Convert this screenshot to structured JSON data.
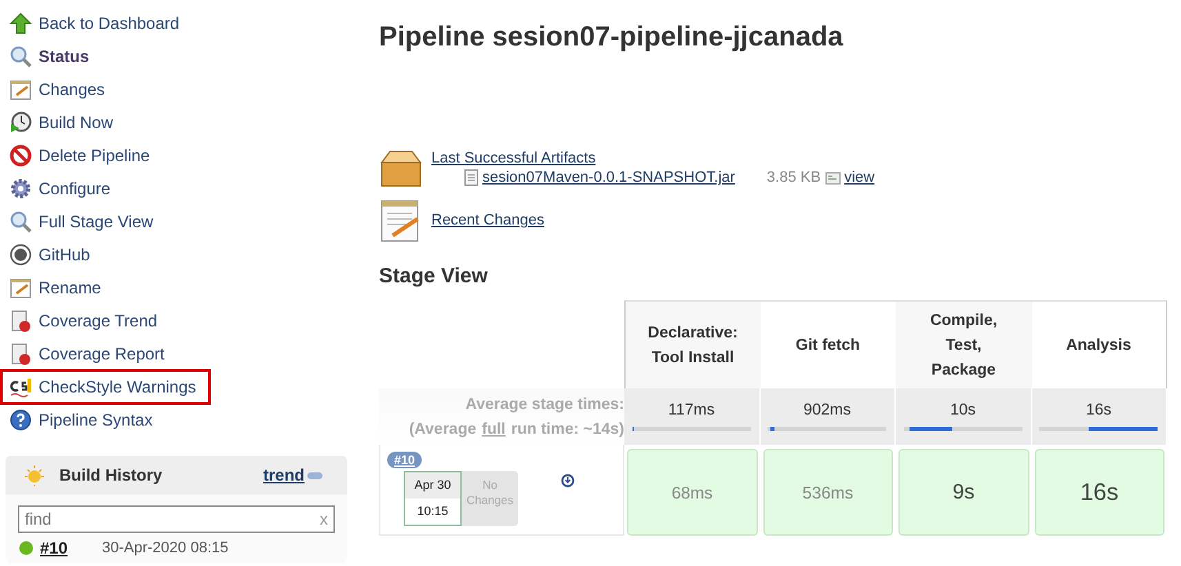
{
  "sidebar": {
    "items": [
      {
        "label": "Back to Dashboard",
        "selected": false,
        "highlighted": false
      },
      {
        "label": "Status",
        "selected": true,
        "highlighted": false
      },
      {
        "label": "Changes",
        "selected": false,
        "highlighted": false
      },
      {
        "label": "Build Now",
        "selected": false,
        "highlighted": false
      },
      {
        "label": "Delete Pipeline",
        "selected": false,
        "highlighted": false
      },
      {
        "label": "Configure",
        "selected": false,
        "highlighted": false
      },
      {
        "label": "Full Stage View",
        "selected": false,
        "highlighted": false
      },
      {
        "label": "GitHub",
        "selected": false,
        "highlighted": false
      },
      {
        "label": "Rename",
        "selected": false,
        "highlighted": false
      },
      {
        "label": "Coverage Trend",
        "selected": false,
        "highlighted": false
      },
      {
        "label": "Coverage Report",
        "selected": false,
        "highlighted": false
      },
      {
        "label": "CheckStyle Warnings",
        "selected": false,
        "highlighted": true
      },
      {
        "label": "Pipeline Syntax",
        "selected": false,
        "highlighted": false
      }
    ]
  },
  "build_history": {
    "title": "Build History",
    "trend_link": "trend",
    "search": {
      "placeholder": "find",
      "clear": "x"
    },
    "builds": [
      {
        "number": "#10",
        "date": "30-Apr-2020 08:15",
        "color": "#6ab820"
      }
    ]
  },
  "title": "Pipeline sesion07-pipeline-jjcanada",
  "artifacts": {
    "link": "Last Successful Artifacts",
    "files": [
      {
        "name": "sesion07Maven-0.0.1-SNAPSHOT.jar",
        "size": "3.85 KB",
        "view": "view"
      }
    ]
  },
  "recent_changes": "Recent Changes",
  "stage_view": {
    "heading": "Stage View",
    "avg_label": "Average stage times:",
    "avg_run_prefix": "(Average",
    "avg_run_link": "full",
    "avg_run_suffix": "run time: ~14s)",
    "stages": [
      {
        "name": "Declarative: Tool Install",
        "avg": "117ms",
        "level": 0.02
      },
      {
        "name": "Git fetch",
        "avg": "902ms",
        "level": 0.03
      },
      {
        "name": "Compile, Test, Package",
        "avg": "10s",
        "level": 0.36
      },
      {
        "name": "Analysis",
        "avg": "16s",
        "level": 0.59
      }
    ],
    "builds": [
      {
        "number": "#10",
        "date": "Apr 30",
        "time": "10:15",
        "changes": "No Changes",
        "durations": [
          "68ms",
          "536ms",
          "9s",
          "16s"
        ]
      }
    ]
  }
}
